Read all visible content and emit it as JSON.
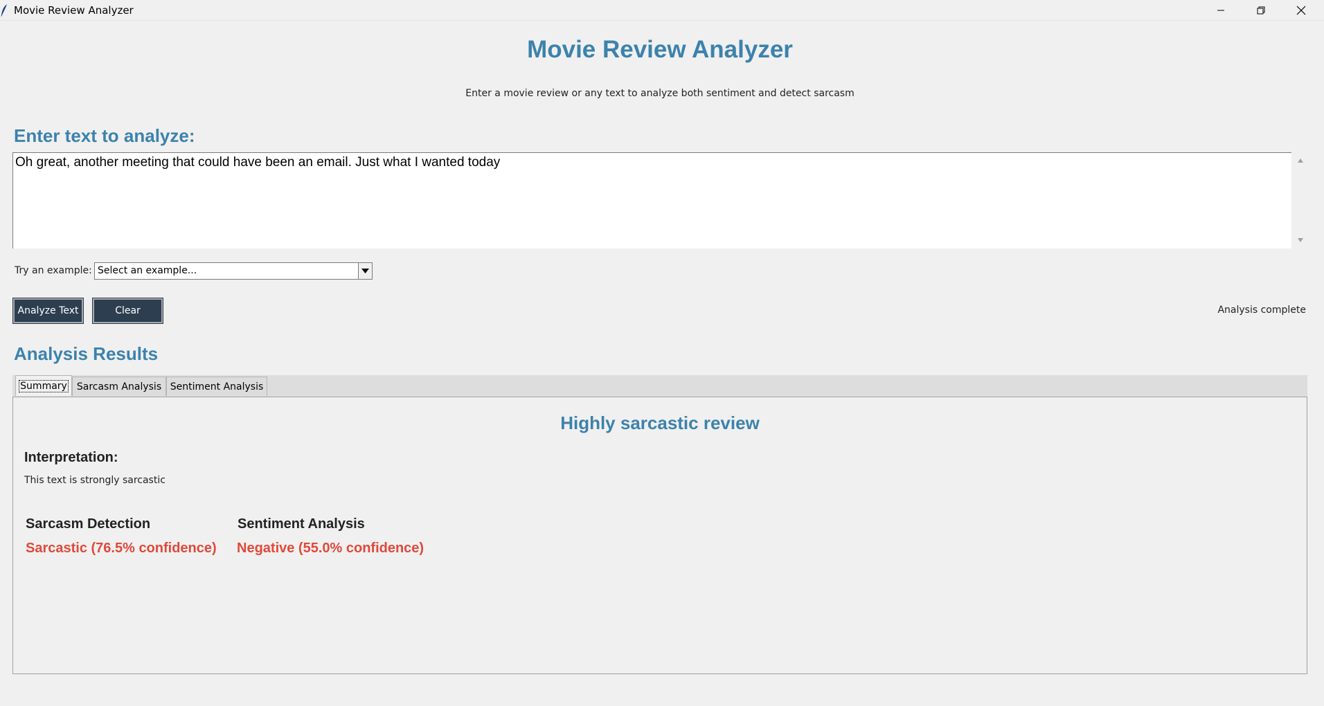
{
  "window": {
    "title": "Movie Review Analyzer",
    "icons": {
      "app": "feather-icon",
      "minimize": "minimize-icon",
      "restore": "restore-icon",
      "close": "close-icon"
    }
  },
  "header": {
    "title": "Movie Review Analyzer",
    "subtitle": "Enter a movie review or any text to analyze both sentiment and detect sarcasm"
  },
  "input": {
    "label": "Enter text to analyze:",
    "value": "Oh great, another meeting that could have been an email. Just what I wanted today"
  },
  "examples": {
    "label": "Try an example:",
    "selected": "Select an example..."
  },
  "actions": {
    "analyze_label": "Analyze Text",
    "clear_label": "Clear",
    "status": "Analysis complete"
  },
  "results": {
    "label": "Analysis Results",
    "tabs": [
      {
        "label": "Summary",
        "active": true
      },
      {
        "label": "Sarcasm Analysis",
        "active": false
      },
      {
        "label": "Sentiment Analysis",
        "active": false
      }
    ],
    "summary": {
      "title": "Highly sarcastic review",
      "interpretation_label": "Interpretation:",
      "interpretation_text": "This text is strongly sarcastic",
      "sarcasm_heading": "Sarcasm Detection",
      "sarcasm_value": "Sarcastic (76.5% confidence)",
      "sentiment_heading": "Sentiment Analysis",
      "sentiment_value": "Negative (55.0% confidence)"
    }
  },
  "colors": {
    "accent": "#3c82ac",
    "button": "#2c3e50",
    "result_value": "#e0493a"
  }
}
